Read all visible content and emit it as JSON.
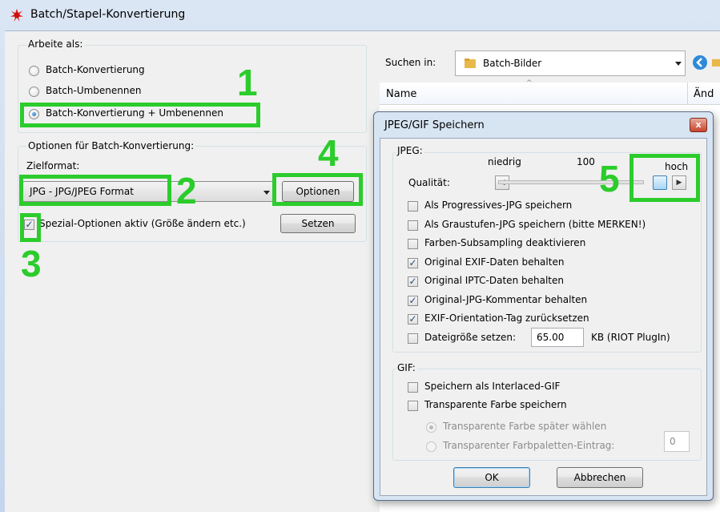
{
  "window": {
    "title": "Batch/Stapel-Konvertierung",
    "icon": "splat-icon"
  },
  "mode_group": {
    "legend": "Arbeite als:",
    "options": [
      {
        "label": "Batch-Konvertierung",
        "selected": false
      },
      {
        "label": "Batch-Umbenennen",
        "selected": false
      },
      {
        "label": "Batch-Konvertierung + Umbenennen",
        "selected": true
      }
    ]
  },
  "conversion_group": {
    "legend": "Optionen für Batch-Konvertierung:",
    "format_label": "Zielformat:",
    "format_value": "JPG - JPG/JPEG Format",
    "options_button": "Optionen",
    "special_label": "Spezial-Optionen aktiv (Größe ändern etc.)",
    "special_checked": true,
    "set_button": "Setzen"
  },
  "file_dialog": {
    "search_label": "Suchen in:",
    "folder": "Batch-Bilder",
    "col_name": "Name",
    "col_changed": "Änd"
  },
  "jpeg_dialog": {
    "title": "JPEG/GIF Speichern",
    "close_glyph": "x",
    "jpeg_legend": "JPEG:",
    "slider_low": "niedrig",
    "slider_value": "100",
    "slider_high": "hoch",
    "quality_label": "Qualität:",
    "quality_level": 1.0,
    "jpeg_options": [
      {
        "label": "Als Progressives-JPG speichern",
        "checked": false
      },
      {
        "label": "Als Graustufen-JPG speichern (bitte MERKEN!)",
        "checked": false
      },
      {
        "label": "Farben-Subsampling deaktivieren",
        "checked": false
      },
      {
        "label": "Original EXIF-Daten behalten",
        "checked": true
      },
      {
        "label": "Original IPTC-Daten behalten",
        "checked": true
      },
      {
        "label": "Original-JPG-Kommentar behalten",
        "checked": true
      },
      {
        "label": "EXIF-Orientation-Tag zurücksetzen",
        "checked": true
      }
    ],
    "filesize_label": "Dateigröße setzen:",
    "filesize_value": "65.00",
    "filesize_unit": "KB (RIOT PlugIn)",
    "gif_legend": "GIF:",
    "gif_interlaced": "Speichern als Interlaced-GIF",
    "gif_transparent": "Transparente Farbe speichern",
    "gif_choose_later": "Transparente Farbe später wählen",
    "gif_palette_entry": "Transparenter Farbpaletten-Eintrag:",
    "gif_palette_value": "0",
    "ok_button": "OK",
    "cancel_button": "Abbrechen"
  },
  "annotations": [
    "1",
    "2",
    "3",
    "4",
    "5"
  ],
  "colors": {
    "annotation_green": "#2bcc2b",
    "close_red": "#c9432b",
    "folder_yellow": "#e8b84a"
  }
}
